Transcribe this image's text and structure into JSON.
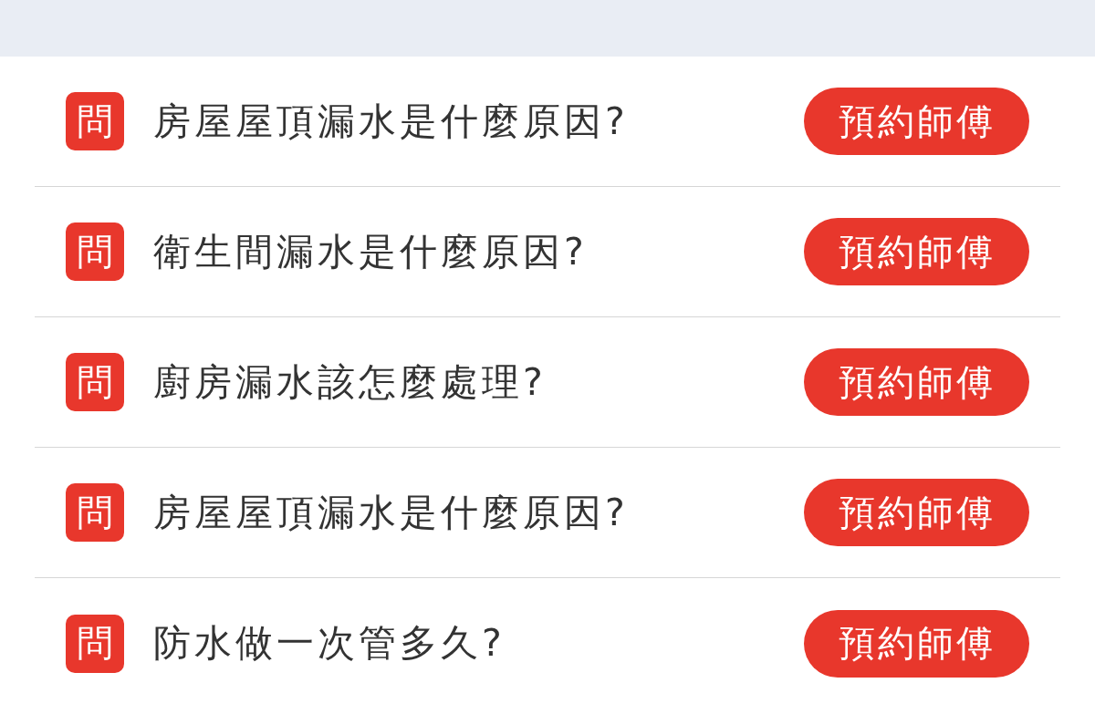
{
  "questions": [
    {
      "badge": "問",
      "text": "房屋屋頂漏水是什麼原因?",
      "button": "預約師傅"
    },
    {
      "badge": "問",
      "text": "衛生間漏水是什麼原因?",
      "button": "預約師傅"
    },
    {
      "badge": "問",
      "text": "廚房漏水該怎麼處理?",
      "button": "預約師傅"
    },
    {
      "badge": "問",
      "text": "房屋屋頂漏水是什麼原因?",
      "button": "預約師傅"
    },
    {
      "badge": "問",
      "text": "防水做一次管多久?",
      "button": "預約師傅"
    }
  ]
}
